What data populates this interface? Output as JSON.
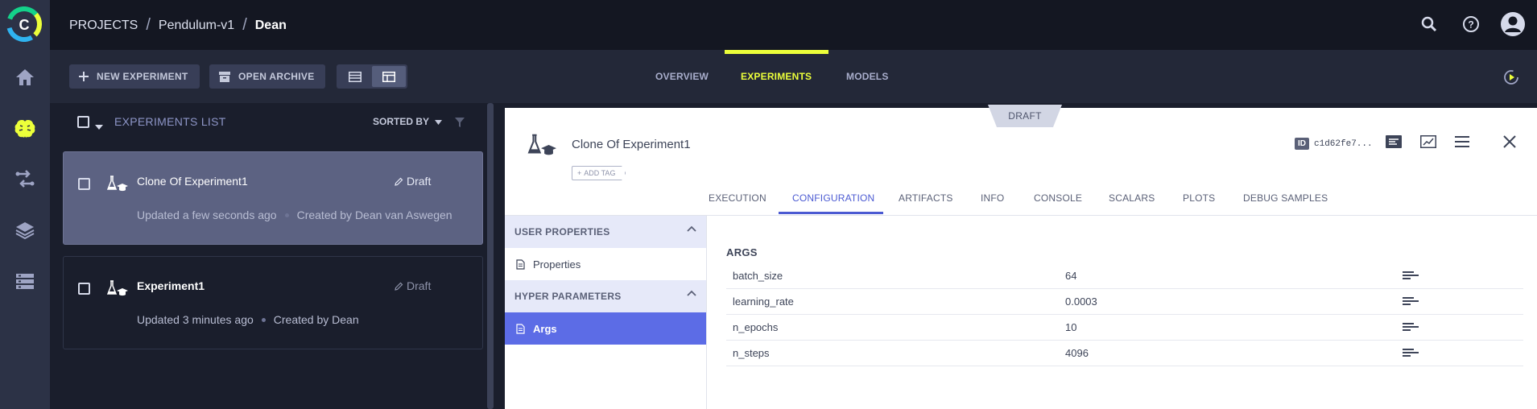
{
  "app": {
    "logo_letter": "C"
  },
  "breadcrumb": {
    "root": "PROJECTS",
    "project": "Pendulum-v1",
    "current": "Dean"
  },
  "toolbar": {
    "new_experiment": "NEW EXPERIMENT",
    "open_archive": "OPEN ARCHIVE"
  },
  "nav_tabs": [
    {
      "label": "OVERVIEW",
      "active": false
    },
    {
      "label": "EXPERIMENTS",
      "active": true
    },
    {
      "label": "MODELS",
      "active": false
    }
  ],
  "list": {
    "title": "EXPERIMENTS LIST",
    "sort_label": "SORTED BY",
    "experiments": [
      {
        "name": "Clone Of Experiment1",
        "status": "Draft",
        "updated": "Updated a few seconds ago",
        "created_by": "Created by Dean van Aswegen",
        "selected": true
      },
      {
        "name": "Experiment1",
        "status": "Draft",
        "updated": "Updated 3 minutes ago",
        "created_by": "Created by Dean",
        "selected": false
      }
    ]
  },
  "details": {
    "status_badge": "DRAFT",
    "title": "Clone Of Experiment1",
    "add_tag": "ADD TAG",
    "id_label": "ID",
    "id_value": "c1d62fe7...",
    "tabs": [
      {
        "label": "EXECUTION",
        "active": false
      },
      {
        "label": "CONFIGURATION",
        "active": true
      },
      {
        "label": "ARTIFACTS",
        "active": false
      },
      {
        "label": "INFO",
        "active": false
      },
      {
        "label": "CONSOLE",
        "active": false
      },
      {
        "label": "SCALARS",
        "active": false
      },
      {
        "label": "PLOTS",
        "active": false
      },
      {
        "label": "DEBUG SAMPLES",
        "active": false
      }
    ],
    "sections": [
      {
        "label": "USER PROPERTIES",
        "items": [
          "Properties"
        ]
      },
      {
        "label": "HYPER PARAMETERS",
        "items": [
          "Args"
        ]
      }
    ],
    "active_item": "Args",
    "params_header": "ARGS",
    "params": [
      {
        "key": "batch_size",
        "value": "64"
      },
      {
        "key": "learning_rate",
        "value": "0.0003"
      },
      {
        "key": "n_epochs",
        "value": "10"
      },
      {
        "key": "n_steps",
        "value": "4096"
      }
    ]
  },
  "colors": {
    "accent_yellow": "#ecff3a",
    "accent_blue": "#5c6ce6",
    "rail_bg": "#2c3246",
    "header_bg": "#141722"
  }
}
